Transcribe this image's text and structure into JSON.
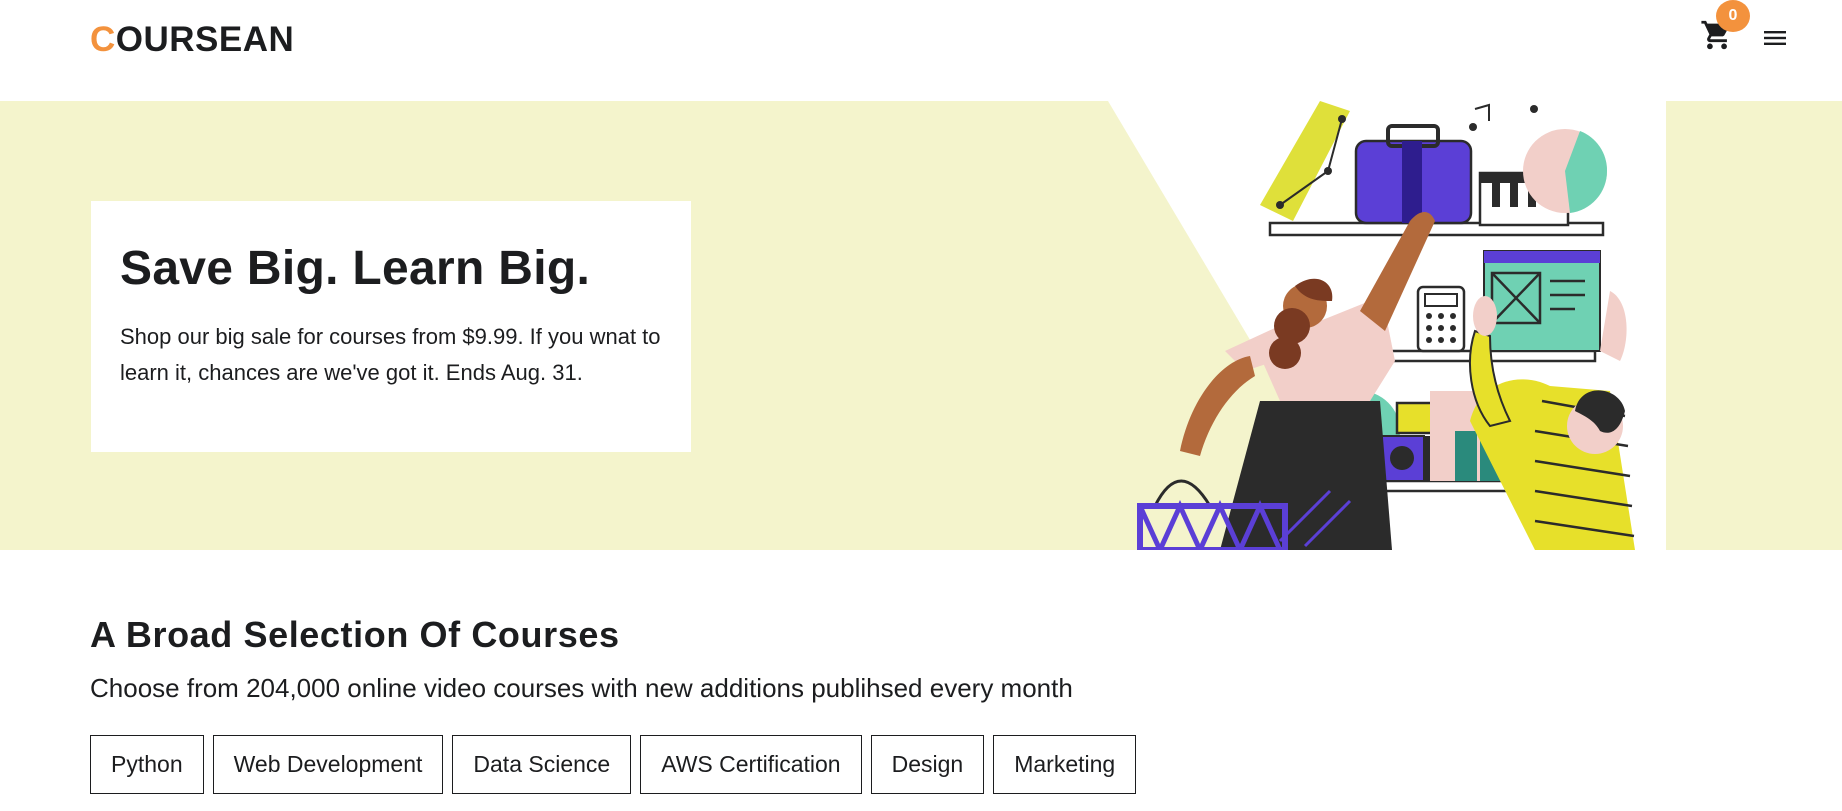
{
  "header": {
    "logo_first": "C",
    "logo_rest": "OURSEAN",
    "cart_count": "0",
    "accent_color": "#f3923d"
  },
  "hero": {
    "title": "Save Big. Learn Big.",
    "text": "Shop our big sale for courses from $9.99. If you wnat to learn it, chances are we've got it. Ends Aug. 31.",
    "background_color": "#f4f4cc"
  },
  "section": {
    "title": "A Broad Selection Of Courses",
    "subtitle": "Choose from 204,000 online video courses with new additions publihsed every month",
    "tabs": [
      "Python",
      "Web Development",
      "Data Science",
      "AWS Certification",
      "Design",
      "Marketing"
    ]
  },
  "icons": [
    "cart-icon",
    "menu-icon"
  ]
}
